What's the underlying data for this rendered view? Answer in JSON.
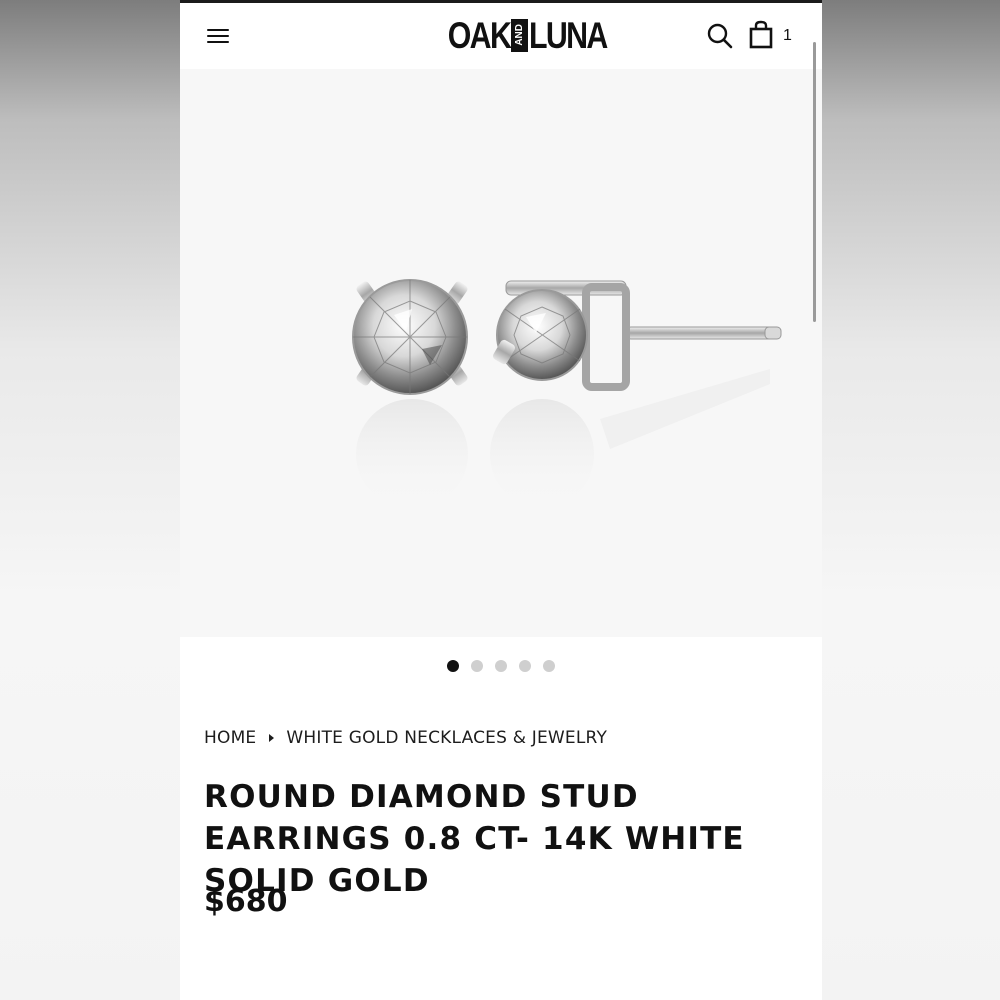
{
  "header": {
    "logo_left": "OAK",
    "logo_middle": "AND",
    "logo_right": "LUNA",
    "cart_count": "1",
    "icons": [
      "menu-icon",
      "search-icon",
      "shopping-bag-icon"
    ]
  },
  "gallery": {
    "image": "diamond-stud-earrings-image",
    "slide_count": 5,
    "active_slide": 1
  },
  "breadcrumb": {
    "home": "HOME",
    "category": "WHITE GOLD NECKLACES & JEWELRY"
  },
  "product": {
    "title": "ROUND DIAMOND STUD EARRINGS 0.8 CT- 14K WHITE SOLID GOLD",
    "price": "$680"
  },
  "colors": {
    "text": "#111111",
    "hero_background": "#f7f7f7",
    "dot_active": "#111111",
    "dot_inactive": "#cfcfcf"
  }
}
